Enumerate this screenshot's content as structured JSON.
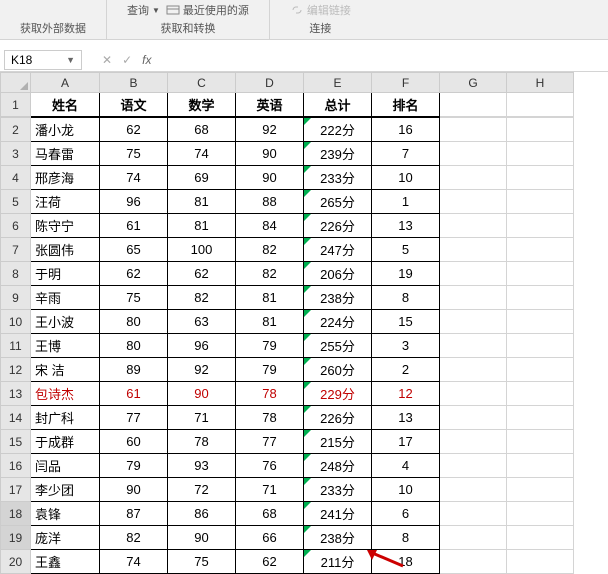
{
  "ribbon": {
    "query_label": "查询",
    "recent_src": "最近使用的源",
    "group1": "获取外部数据",
    "group2": "获取和转换",
    "edit_link": "编辑链接",
    "group3": "连接"
  },
  "namebox": {
    "ref": "K18",
    "fx": "fx"
  },
  "columns": [
    "A",
    "B",
    "C",
    "D",
    "E",
    "F",
    "G",
    "H"
  ],
  "headers": {
    "name": "姓名",
    "yuwen": "语文",
    "shuxue": "数学",
    "yingyu": "英语",
    "zongji": "总计",
    "paiming": "排名"
  },
  "rows": [
    {
      "n": "潘小龙",
      "y": "62",
      "s": "68",
      "e": "92",
      "t": "222分",
      "r": "16"
    },
    {
      "n": "马春雷",
      "y": "75",
      "s": "74",
      "e": "90",
      "t": "239分",
      "r": "7"
    },
    {
      "n": "邢彦海",
      "y": "74",
      "s": "69",
      "e": "90",
      "t": "233分",
      "r": "10"
    },
    {
      "n": "汪荷",
      "y": "96",
      "s": "81",
      "e": "88",
      "t": "265分",
      "r": "1"
    },
    {
      "n": "陈守宁",
      "y": "61",
      "s": "81",
      "e": "84",
      "t": "226分",
      "r": "13"
    },
    {
      "n": "张圆伟",
      "y": "65",
      "s": "100",
      "e": "82",
      "t": "247分",
      "r": "5"
    },
    {
      "n": "于明",
      "y": "62",
      "s": "62",
      "e": "82",
      "t": "206分",
      "r": "19"
    },
    {
      "n": "辛雨",
      "y": "75",
      "s": "82",
      "e": "81",
      "t": "238分",
      "r": "8"
    },
    {
      "n": "王小波",
      "y": "80",
      "s": "63",
      "e": "81",
      "t": "224分",
      "r": "15"
    },
    {
      "n": "王博",
      "y": "80",
      "s": "96",
      "e": "79",
      "t": "255分",
      "r": "3"
    },
    {
      "n": "宋 洁",
      "y": "89",
      "s": "92",
      "e": "79",
      "t": "260分",
      "r": "2"
    },
    {
      "n": "包诗杰",
      "y": "61",
      "s": "90",
      "e": "78",
      "t": "229分",
      "r": "12",
      "red": true
    },
    {
      "n": "封广科",
      "y": "77",
      "s": "71",
      "e": "78",
      "t": "226分",
      "r": "13"
    },
    {
      "n": "于成群",
      "y": "60",
      "s": "78",
      "e": "77",
      "t": "215分",
      "r": "17"
    },
    {
      "n": "闫品",
      "y": "79",
      "s": "93",
      "e": "76",
      "t": "248分",
      "r": "4"
    },
    {
      "n": "李少团",
      "y": "90",
      "s": "72",
      "e": "71",
      "t": "233分",
      "r": "10"
    },
    {
      "n": "袁锋",
      "y": "87",
      "s": "86",
      "e": "68",
      "t": "241分",
      "r": "6",
      "sel": true
    },
    {
      "n": "庞洋",
      "y": "82",
      "s": "90",
      "e": "66",
      "t": "238分",
      "r": "8",
      "sel": true
    },
    {
      "n": "王鑫",
      "y": "74",
      "s": "75",
      "e": "62",
      "t": "211分",
      "r": "18"
    }
  ]
}
